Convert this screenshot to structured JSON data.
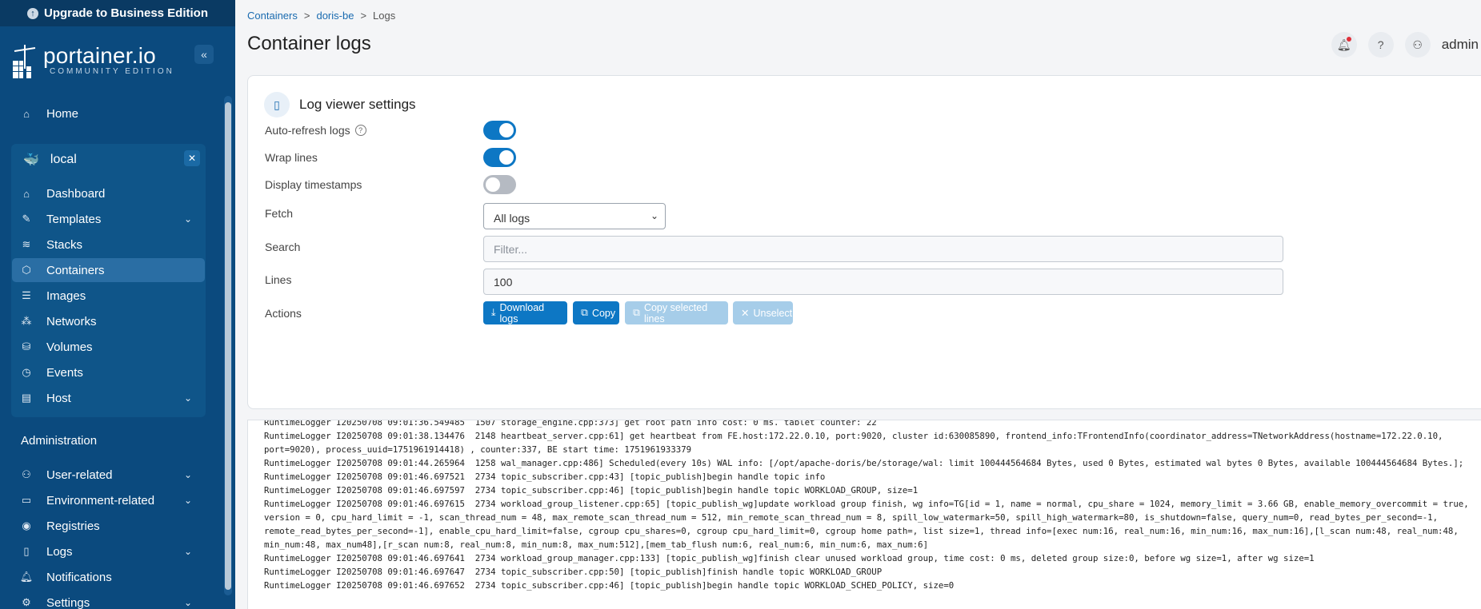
{
  "upgrade": {
    "label": "Upgrade to Business Edition"
  },
  "logo": {
    "name": "portainer.io",
    "edition": "COMMUNITY EDITION"
  },
  "sidebar": {
    "home": "Home",
    "environment": {
      "name": "local"
    },
    "env_items": [
      {
        "label": "Dashboard",
        "icon": "dashboard-icon"
      },
      {
        "label": "Templates",
        "icon": "templates-icon"
      },
      {
        "label": "Stacks",
        "icon": "stacks-icon"
      },
      {
        "label": "Containers",
        "icon": "containers-icon"
      },
      {
        "label": "Images",
        "icon": "images-icon"
      },
      {
        "label": "Networks",
        "icon": "networks-icon"
      },
      {
        "label": "Volumes",
        "icon": "volumes-icon"
      },
      {
        "label": "Events",
        "icon": "events-icon"
      },
      {
        "label": "Host",
        "icon": "host-icon"
      }
    ],
    "admin_title": "Administration",
    "admin_items": [
      {
        "label": "User-related",
        "icon": "users-icon"
      },
      {
        "label": "Environment-related",
        "icon": "environment-icon"
      },
      {
        "label": "Registries",
        "icon": "registries-icon"
      },
      {
        "label": "Logs",
        "icon": "logs-icon"
      },
      {
        "label": "Notifications",
        "icon": "bell-icon"
      },
      {
        "label": "Settings",
        "icon": "gear-icon"
      }
    ]
  },
  "breadcrumb": {
    "a": "Containers",
    "b": "doris-be",
    "c": "Logs",
    "sep": ">"
  },
  "header": {
    "title": "Container logs",
    "user": "admin"
  },
  "settings": {
    "title": "Log viewer settings",
    "auto_refresh_label": "Auto-refresh logs",
    "auto_refresh": true,
    "wrap_label": "Wrap lines",
    "wrap": true,
    "timestamps_label": "Display timestamps",
    "timestamps": false,
    "fetch_label": "Fetch",
    "fetch_value": "All logs",
    "search_label": "Search",
    "search_placeholder": "Filter...",
    "lines_label": "Lines",
    "lines_value": "100",
    "actions_label": "Actions",
    "btn_download": "Download logs",
    "btn_copy": "Copy",
    "btn_copy_selected": "Copy selected lines",
    "btn_unselect": "Unselect"
  },
  "logs": [
    "RuntimeLogger I20250708 09:01:36.549485  1507 storage_engine.cpp:373] get root path info cost: 0 ms. tablet counter: 22",
    "RuntimeLogger I20250708 09:01:38.134476  2148 heartbeat_server.cpp:61] get heartbeat from FE.host:172.22.0.10, port:9020, cluster id:630085890, frontend_info:TFrontendInfo(coordinator_address=TNetworkAddress(hostname=172.22.0.10, port=9020), process_uuid=1751961914418) , counter:337, BE start time: 1751961933379",
    "RuntimeLogger I20250708 09:01:44.265964  1258 wal_manager.cpp:486] Scheduled(every 10s) WAL info: [/opt/apache-doris/be/storage/wal: limit 100444564684 Bytes, used 0 Bytes, estimated wal bytes 0 Bytes, available 100444564684 Bytes.];",
    "RuntimeLogger I20250708 09:01:46.697521  2734 topic_subscriber.cpp:43] [topic_publish]begin handle topic info",
    "RuntimeLogger I20250708 09:01:46.697597  2734 topic_subscriber.cpp:46] [topic_publish]begin handle topic WORKLOAD_GROUP, size=1",
    "RuntimeLogger I20250708 09:01:46.697615  2734 workload_group_listener.cpp:65] [topic_publish_wg]update workload group finish, wg info=TG[id = 1, name = normal, cpu_share = 1024, memory_limit = 3.66 GB, enable_memory_overcommit = true, version = 0, cpu_hard_limit = -1, scan_thread_num = 48, max_remote_scan_thread_num = 512, min_remote_scan_thread_num = 8, spill_low_watermark=50, spill_high_watermark=80, is_shutdown=false, query_num=0, read_bytes_per_second=-1, remote_read_bytes_per_second=-1], enable_cpu_hard_limit=false, cgroup cpu_shares=0, cgroup cpu_hard_limit=0, cgroup home path=, list size=1, thread info=[exec num:16, real_num:16, min_num:16, max_num:16],[l_scan num:48, real_num:48, min_num:48, max_num48],[r_scan num:8, real_num:8, min_num:8, max_num:512],[mem_tab_flush num:6, real_num:6, min_num:6, max_num:6]",
    "RuntimeLogger I20250708 09:01:46.697641  2734 workload_group_manager.cpp:133] [topic_publish_wg]finish clear unused workload group, time cost: 0 ms, deleted group size:0, before wg size=1, after wg size=1",
    "RuntimeLogger I20250708 09:01:46.697647  2734 topic_subscriber.cpp:50] [topic_publish]finish handle topic WORKLOAD_GROUP",
    "RuntimeLogger I20250708 09:01:46.697652  2734 topic_subscriber.cpp:46] [topic_publish]begin handle topic WORKLOAD_SCHED_POLICY, size=0"
  ]
}
